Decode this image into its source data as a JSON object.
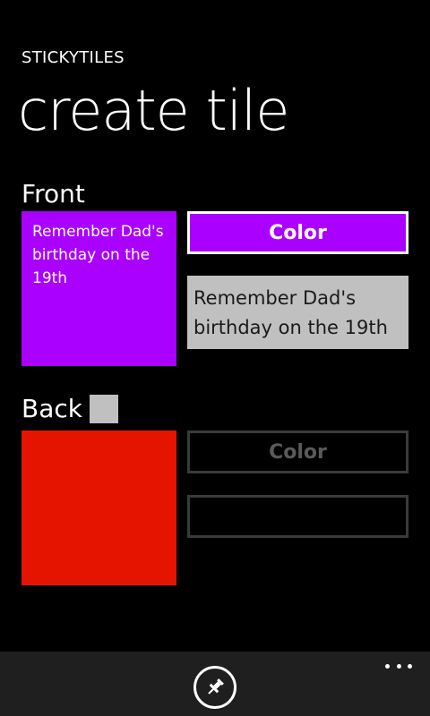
{
  "header": {
    "app_title": "STICKYTILES",
    "page_title": "create tile"
  },
  "front": {
    "label": "Front",
    "tile_text": "Remember Dad's birthday on the 19th",
    "tile_color": "#aa00ff",
    "color_button_label": "Color",
    "text_value": "Remember Dad's birthday on the 19th"
  },
  "back": {
    "label": "Back",
    "enabled": false,
    "tile_color": "#e51400",
    "color_button_label": "Color",
    "text_value": ""
  },
  "app_bar": {
    "pin_icon": "pin-icon",
    "more_icon": "more-icon"
  },
  "colors": {
    "background": "#000000",
    "app_bar": "#1f1f1f",
    "disabled_border": "#3a3a3a",
    "text_box_fill": "#c0c0c0"
  }
}
